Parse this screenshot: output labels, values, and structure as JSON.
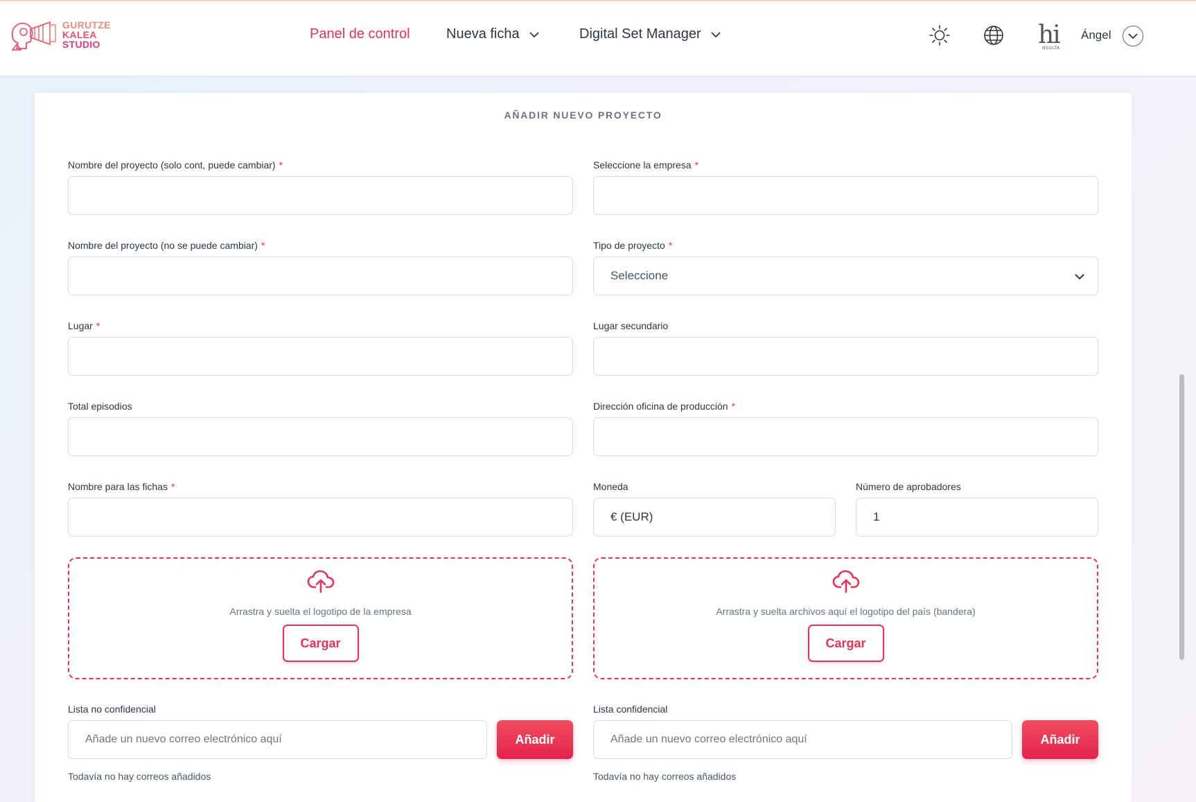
{
  "brand": {
    "line1": "GURUTZE",
    "line2": "KALEA",
    "line3": "STUDIO"
  },
  "nav": {
    "items": [
      {
        "label": "Panel de control",
        "active": true
      },
      {
        "label": "Nueva ficha",
        "has_dropdown": true
      },
      {
        "label": "Digital Set Manager",
        "has_dropdown": true
      }
    ]
  },
  "header_icons": [
    "sun-icon",
    "globe-icon"
  ],
  "user": {
    "avatar_text": "hi",
    "avatar_subtext": "NSULTA",
    "name": "Ángel"
  },
  "form": {
    "title": "AÑADIR NUEVO PROYECTO",
    "required_mark": "*",
    "fields": {
      "project_name_editable": {
        "label": "Nombre del proyecto (solo cont, puede cambiar)",
        "required": true,
        "value": ""
      },
      "company": {
        "label": "Seleccione la empresa",
        "required": true,
        "value": ""
      },
      "project_name_fixed": {
        "label": "Nombre del proyecto (no se puede cambiar)",
        "required": true,
        "value": ""
      },
      "project_type": {
        "label": "Tipo de proyecto",
        "required": true,
        "value": "Seleccione"
      },
      "place": {
        "label": "Lugar",
        "required": true,
        "value": ""
      },
      "secondary_place": {
        "label": "Lugar secundario",
        "required": false,
        "value": ""
      },
      "total_episodes": {
        "label": "Total episodios",
        "required": false,
        "value": ""
      },
      "office_address": {
        "label": "Dirección oficina de producción",
        "required": true,
        "value": ""
      },
      "sheet_name": {
        "label": "Nombre para las fichas",
        "required": true,
        "value": ""
      },
      "currency": {
        "label": "Moneda",
        "required": false,
        "value": "€ (EUR)"
      },
      "approvers": {
        "label": "Número de aprobadores",
        "required": false,
        "value": "1"
      }
    },
    "uploads": {
      "company_logo": {
        "text": "Arrastra y suelta el logotipo de la empresa",
        "button": "Cargar"
      },
      "country_flag": {
        "text": "Arrastra y suelta archivos aquí el logotipo del país (bandera)",
        "button": "Cargar"
      }
    },
    "lists": {
      "non_confidential": {
        "label": "Lista no confidencial",
        "placeholder": "Añade un nuevo correo electrónico aquí",
        "button": "Añadir",
        "empty_note": "Todavía no hay correos añadidos"
      },
      "confidential": {
        "label": "Lista confidencial",
        "placeholder": "Añade un nuevo correo electrónico aquí",
        "button": "Añadir",
        "empty_note": "Todavía no hay correos añadidos"
      }
    }
  },
  "colors": {
    "accent": "#ec2f56",
    "button_gradient_top": "#f24d5d",
    "button_gradient_bottom": "#e5224d",
    "border": "#d9dce3",
    "text": "#2f3542"
  }
}
